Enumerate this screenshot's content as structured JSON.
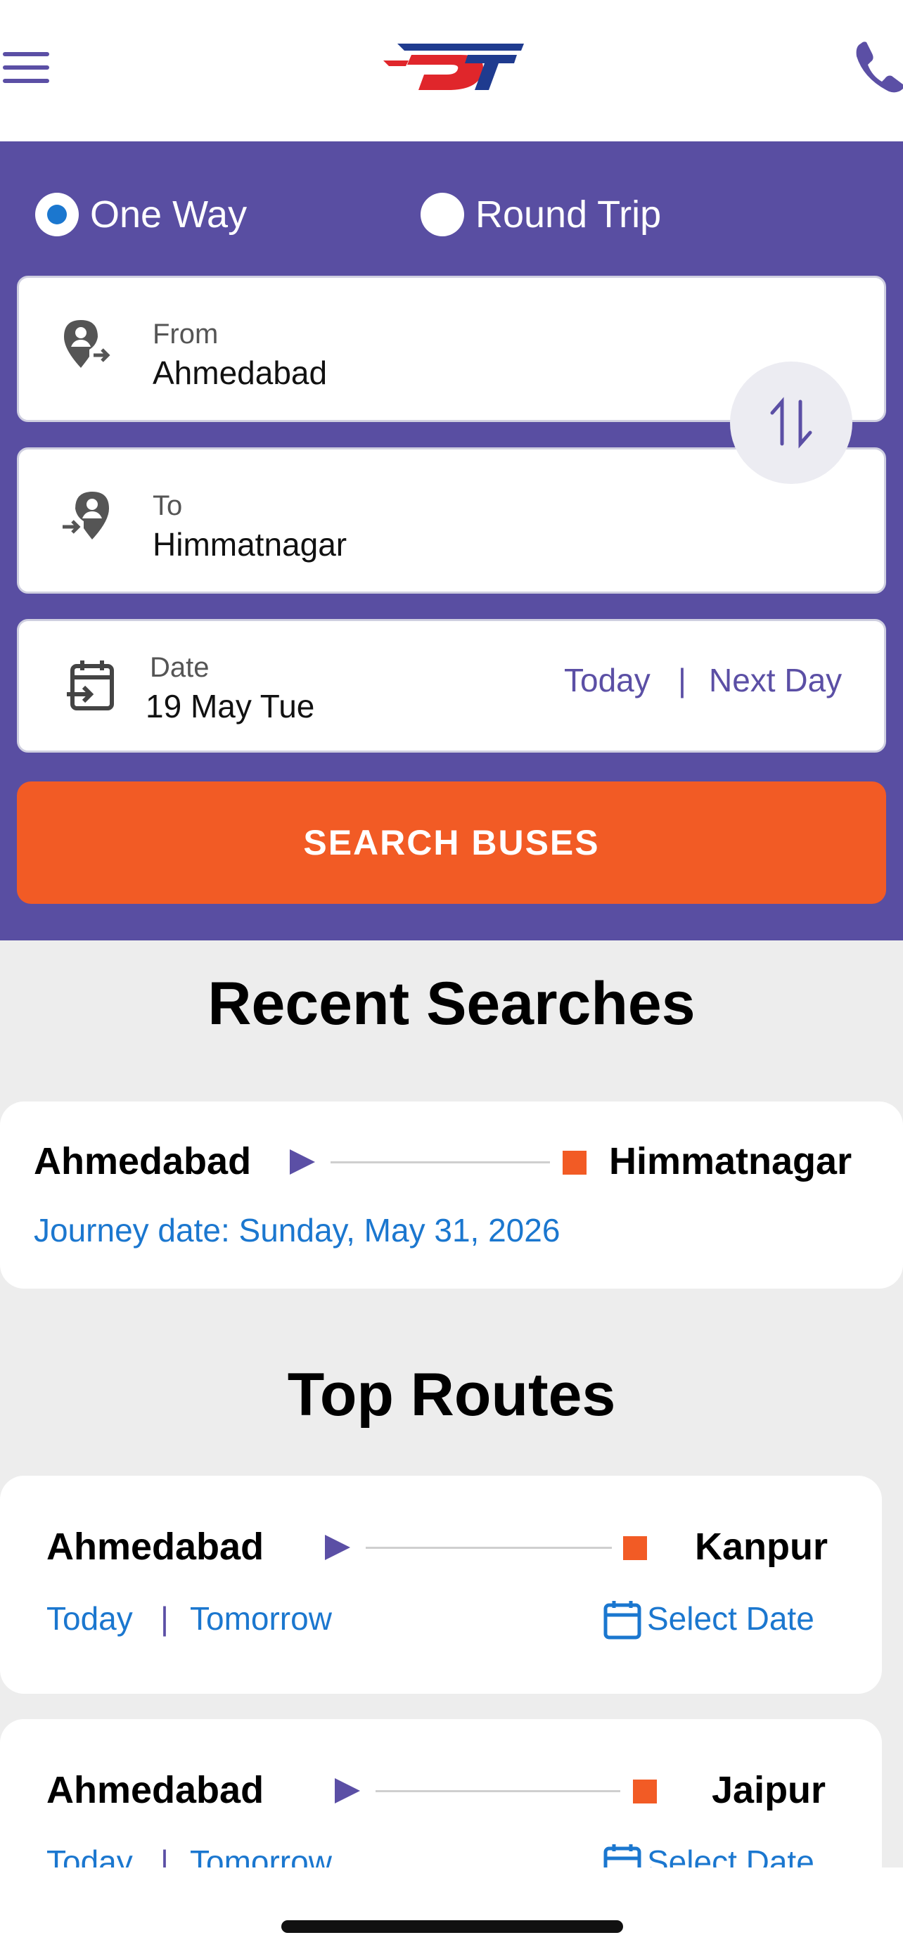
{
  "header": {
    "logo_text": "DT"
  },
  "trip_type": {
    "one_way": "One Way",
    "round_trip": "Round Trip",
    "selected": "One Way"
  },
  "from": {
    "label": "From",
    "value": "Ahmedabad"
  },
  "to": {
    "label": "To",
    "value": "Himmatnagar"
  },
  "date": {
    "label": "Date",
    "value": "19 May Tue",
    "today": "Today",
    "separator": "|",
    "next_day": "Next Day"
  },
  "search_button": "SEARCH BUSES",
  "recent": {
    "title": "Recent Searches",
    "items": [
      {
        "from": "Ahmedabad",
        "to": "Himmatnagar",
        "journey": "Journey date: Sunday, May 31, 2026"
      }
    ]
  },
  "top_routes": {
    "title": "Top Routes",
    "today": "Today",
    "separator": "|",
    "tomorrow": "Tomorrow",
    "select_date": "Select Date",
    "items": [
      {
        "from": "Ahmedabad",
        "to": "Kanpur"
      },
      {
        "from": "Ahmedabad",
        "to": "Jaipur"
      }
    ]
  },
  "colors": {
    "brand_purple": "#594ea2",
    "accent_orange": "#f25b25",
    "link_blue": "#1b77cf"
  }
}
